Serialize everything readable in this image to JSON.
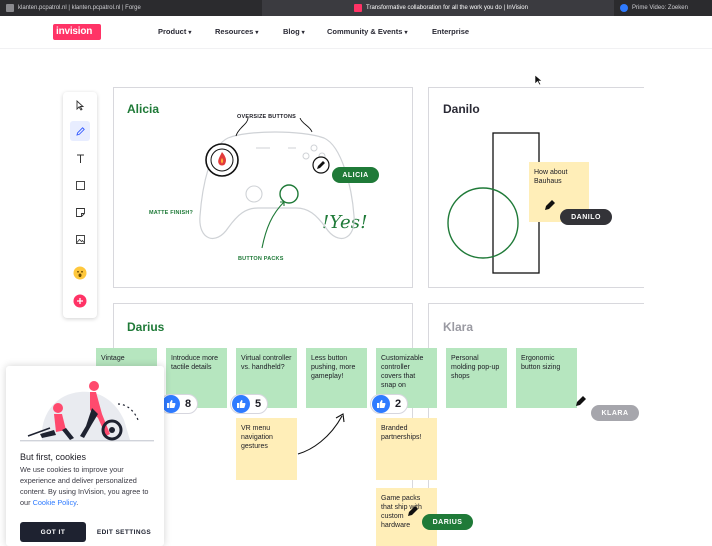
{
  "browser": {
    "tabs": [
      {
        "label": "klanten.pcpatrol.nl | klanten.pcpatrol.nl | Forge"
      },
      {
        "label": "Transformative collaboration for all the work you do | InVision"
      },
      {
        "label": "Prime Video: Zoeken"
      }
    ]
  },
  "nav": {
    "logo": "invision",
    "items": [
      {
        "label": "Product"
      },
      {
        "label": "Resources"
      },
      {
        "label": "Blog"
      },
      {
        "label": "Community & Events"
      },
      {
        "label": "Enterprise"
      }
    ]
  },
  "toolbar": {
    "tools": [
      "select-icon",
      "pen-icon",
      "text-icon",
      "rectangle-icon",
      "sticky-note-icon",
      "image-icon",
      "emoji-icon",
      "add-icon"
    ],
    "active": "pen-icon"
  },
  "panels": {
    "alicia": {
      "name": "Alicia",
      "annotations": {
        "oversize": "OVERSIZE BUTTONS",
        "matte": "MATTE FINISH?",
        "packs": "BUTTON PACKS",
        "yes": "!Yes!"
      },
      "cursor_label": "ALICIA"
    },
    "danilo": {
      "name": "Danilo",
      "note": "How about Bauhaus",
      "cursor_label": "DANILO"
    },
    "darius": {
      "name": "Darius",
      "cursor_label": "DARIUS"
    },
    "klara": {
      "name": "Klara",
      "cursor_label": "KLARA"
    }
  },
  "notes": {
    "vintage": "Vintage",
    "tactile": "Introduce more tactile details",
    "virtual": "Virtual controller vs. handheld?",
    "less_button": "Less button pushing, more gameplay!",
    "covers": "Customizable controller covers that snap on",
    "personal": "Personal molding pop-up shops",
    "ergonomic": "Ergonomic button sizing",
    "vr_menu": "VR menu navigation gestures",
    "branded": "Branded partnerships!",
    "game_packs": "Game packs that ship with custom hardware"
  },
  "votes": {
    "tactile": "8",
    "virtual": "5",
    "covers": "2"
  },
  "cookie": {
    "title": "But first, cookies",
    "body": "We use cookies to improve your experience and deliver personalized content. By using InVision, you agree to our ",
    "link": "Cookie Policy",
    "period": ".",
    "got_it": "GOT IT",
    "settings": "EDIT SETTINGS"
  },
  "colors": {
    "brand": "#ff3366",
    "green": "#1f7a38",
    "sticky_green": "#b6e6bf",
    "sticky_yellow": "#ffeeb8",
    "vote_blue": "#2f7bff"
  }
}
